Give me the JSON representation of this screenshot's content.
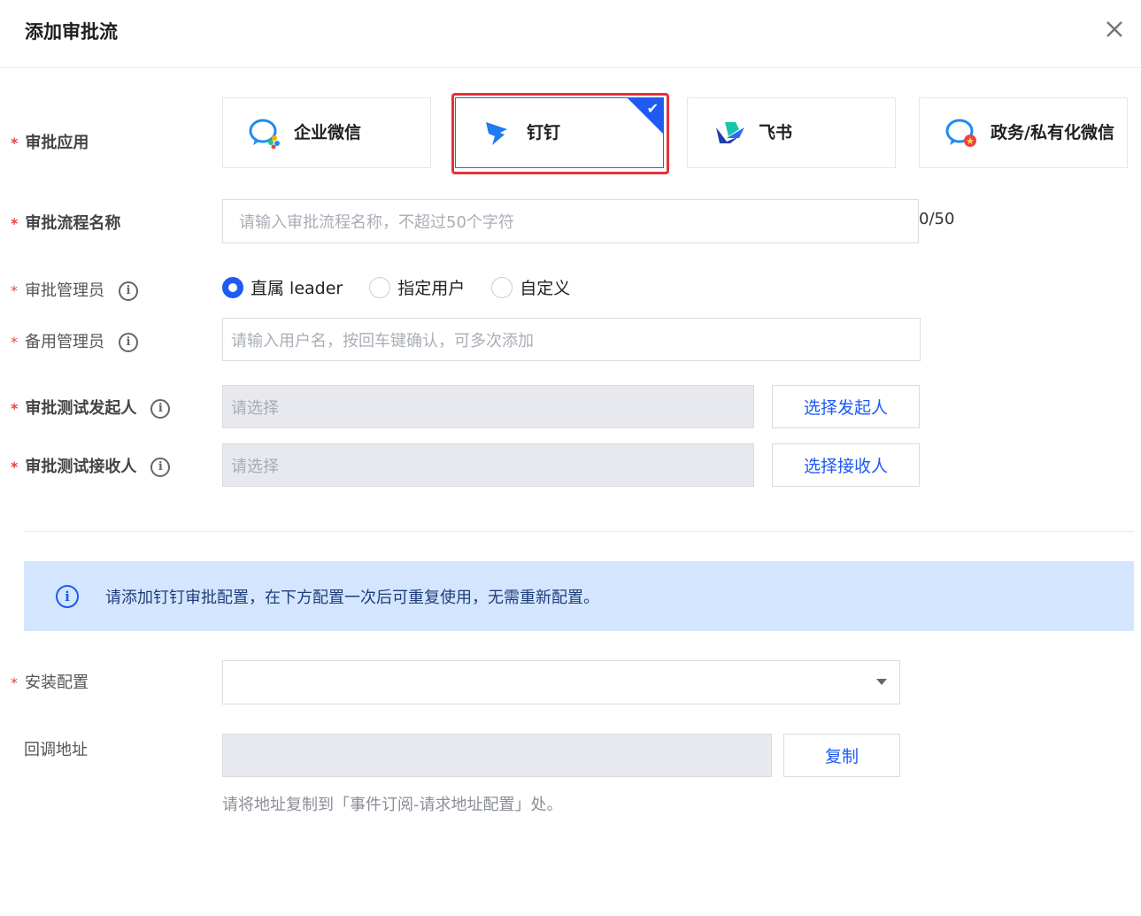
{
  "dialog": {
    "title": "添加审批流",
    "close_label": "✕"
  },
  "form": {
    "app": {
      "label": "审批应用",
      "options": [
        {
          "name": "企业微信",
          "icon": "wecom-icon"
        },
        {
          "name": "钉钉",
          "icon": "dingtalk-icon",
          "selected": true
        },
        {
          "name": "飞书",
          "icon": "feishu-icon"
        },
        {
          "name": "政务/私有化微信",
          "icon": "gov-wechat-icon"
        }
      ],
      "check": "✔"
    },
    "flow_name": {
      "label": "审批流程名称",
      "placeholder": "请输入审批流程名称，不超过50个字符",
      "counter": "0/50"
    },
    "admin": {
      "label": "审批管理员",
      "options": [
        "直属 leader",
        "指定用户",
        "自定义"
      ],
      "selected": "直属 leader"
    },
    "backup_admin": {
      "label": "备用管理员",
      "placeholder": "请输入用户名，按回车键确认，可多次添加"
    },
    "test_initiator": {
      "label": "审批测试发起人",
      "placeholder": "请选择",
      "button": "选择发起人"
    },
    "test_receiver": {
      "label": "审批测试接收人",
      "placeholder": "请选择",
      "button": "选择接收人"
    },
    "info_banner": "请添加钉钉审批配置，在下方配置一次后可重复使用，无需重新配置。",
    "install_config": {
      "label": "安装配置",
      "value": ""
    },
    "callback": {
      "label": "回调地址",
      "value": "",
      "button": "复制",
      "hint": "请将地址复制到「事件订阅-请求地址配置」处。"
    },
    "required_mark": "*",
    "info_icon": "i"
  },
  "colors": {
    "accent": "#1e5af3",
    "required": "#e54545",
    "highlight_outline": "#e8313a",
    "banner_bg": "#d4e6ff"
  }
}
